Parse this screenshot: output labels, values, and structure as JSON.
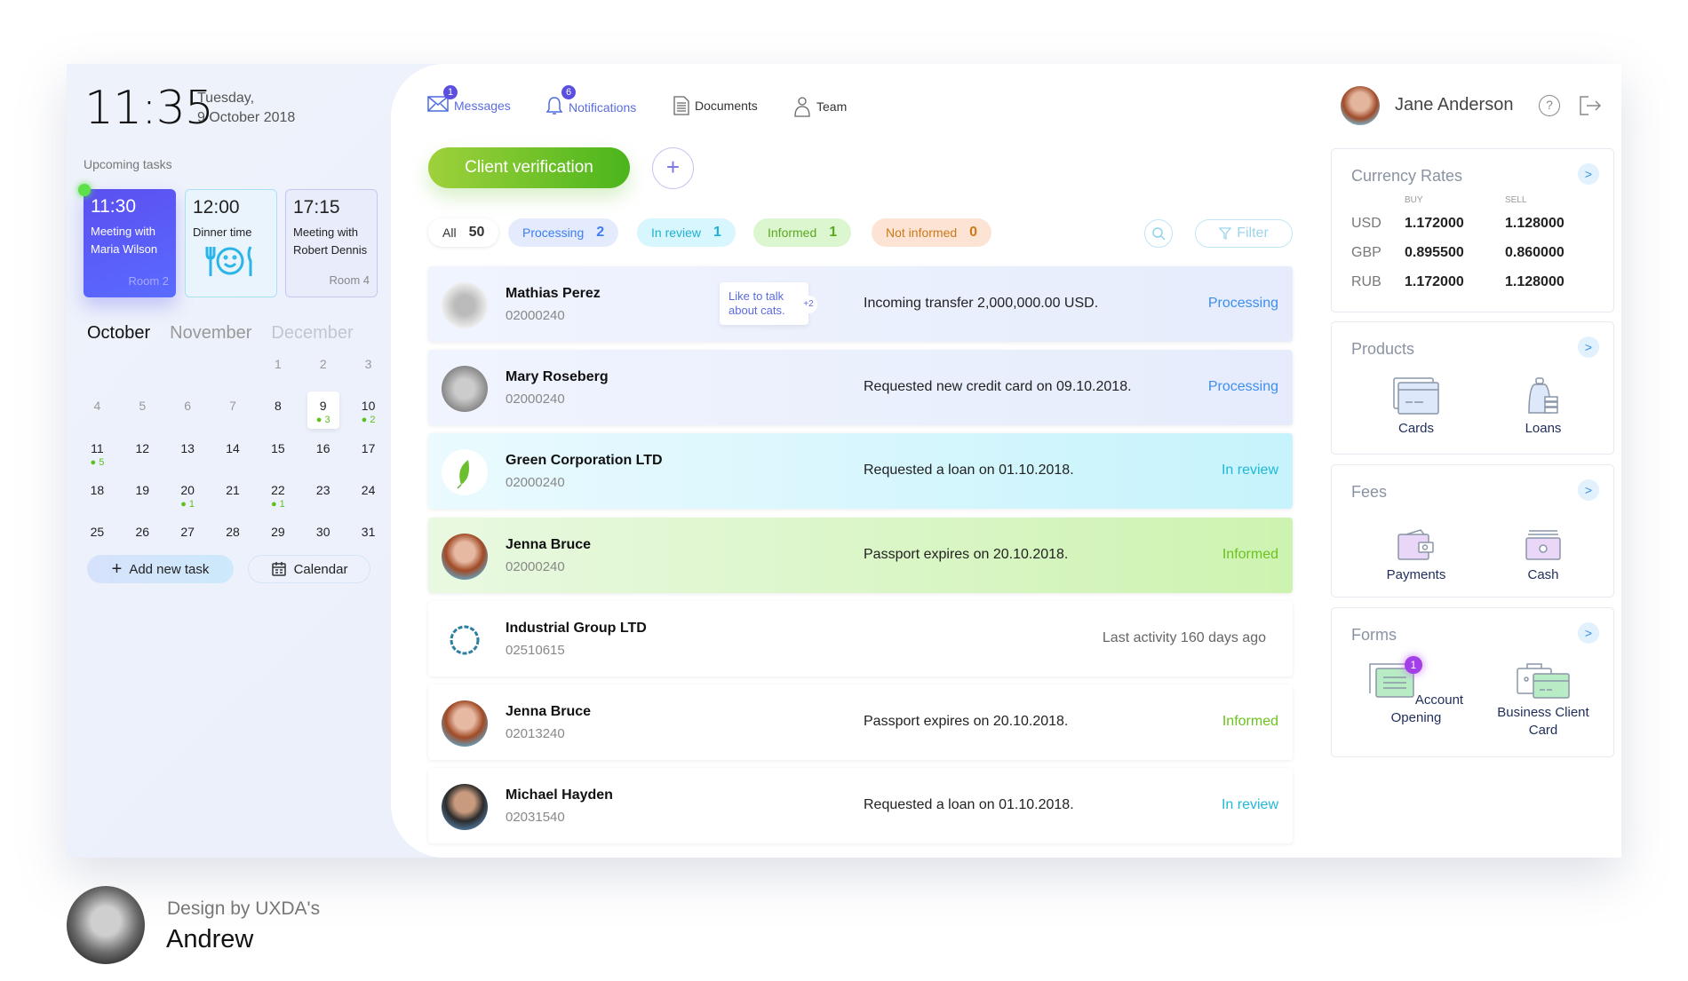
{
  "clock": {
    "time": "11:35",
    "weekday": "Tuesday,",
    "date": "9 October 2018"
  },
  "tasks": {
    "label": "Upcoming tasks",
    "items": [
      {
        "time": "11:30",
        "title": "Meeting with Maria Wilson",
        "room": "Room 2"
      },
      {
        "time": "12:00",
        "title": "Dinner time",
        "room": ""
      },
      {
        "time": "17:15",
        "title": "Meeting with Robert Dennis",
        "room": "Room 4"
      }
    ]
  },
  "calendar": {
    "months": [
      "October",
      "November",
      "December"
    ],
    "selected_day": "9",
    "days": [
      {
        "d": ""
      },
      {
        "d": ""
      },
      {
        "d": ""
      },
      {
        "d": ""
      },
      {
        "d": "1"
      },
      {
        "d": "2"
      },
      {
        "d": "3"
      },
      {
        "d": "4"
      },
      {
        "d": "5"
      },
      {
        "d": "6"
      },
      {
        "d": "7"
      },
      {
        "d": "8"
      },
      {
        "d": "9",
        "e": "3"
      },
      {
        "d": "10",
        "e": "2"
      },
      {
        "d": "11",
        "e": "5"
      },
      {
        "d": "12"
      },
      {
        "d": "13"
      },
      {
        "d": "14"
      },
      {
        "d": "15"
      },
      {
        "d": "16"
      },
      {
        "d": "17"
      },
      {
        "d": "18"
      },
      {
        "d": "19"
      },
      {
        "d": "20",
        "e": "1"
      },
      {
        "d": "21"
      },
      {
        "d": "22",
        "e": "1"
      },
      {
        "d": "23"
      },
      {
        "d": "24"
      },
      {
        "d": "25"
      },
      {
        "d": "26"
      },
      {
        "d": "27"
      },
      {
        "d": "28"
      },
      {
        "d": "29"
      },
      {
        "d": "30"
      },
      {
        "d": "31"
      }
    ],
    "add_task": "Add new task",
    "calendar_button": "Calendar"
  },
  "nav": [
    {
      "label": "Messages",
      "badge": "1",
      "icon": "envelope-icon"
    },
    {
      "label": "Notifications",
      "badge": "6",
      "icon": "bell-icon"
    },
    {
      "label": "Documents",
      "icon": "document-icon"
    },
    {
      "label": "Team",
      "icon": "person-icon"
    }
  ],
  "user": {
    "name": "Jane Anderson"
  },
  "actions": {
    "client_verification": "Client verification",
    "filter": "Filter"
  },
  "filters": [
    {
      "label": "All",
      "count": "50"
    },
    {
      "label": "Processing",
      "count": "2"
    },
    {
      "label": "In review",
      "count": "1"
    },
    {
      "label": "Informed",
      "count": "1"
    },
    {
      "label": "Not informed",
      "count": "0"
    }
  ],
  "clients": [
    {
      "name": "Mathias Perez",
      "id": "02000240",
      "note": "Like to talk about cats.",
      "note_more": "+2",
      "message": "Incoming transfer 2,000,000.00 USD.",
      "status": "Processing"
    },
    {
      "name": "Mary Roseberg",
      "id": "02000240",
      "message": "Requested new credit card on 09.10.2018.",
      "status": "Processing"
    },
    {
      "name": "Green Corporation LTD",
      "id": "02000240",
      "message": "Requested a loan on 01.10.2018.",
      "status": "In review"
    },
    {
      "name": "Jenna Bruce",
      "id": "02000240",
      "message": "Passport expires on 20.10.2018.",
      "status": "Informed"
    },
    {
      "name": "Industrial Group LTD",
      "id": "02510615",
      "message": "Last activity 160 days ago",
      "status": ""
    },
    {
      "name": "Jenna Bruce",
      "id": "02013240",
      "message": "Passport expires on 20.10.2018.",
      "status": "Informed"
    },
    {
      "name": "Michael Hayden",
      "id": "02031540",
      "message": "Requested a loan on 01.10.2018.",
      "status": "In review"
    }
  ],
  "status_colors": {
    "Processing": "#3d8ef0",
    "In review": "#20b8d8",
    "Informed": "#6cc21f"
  },
  "currency": {
    "title": "Currency Rates",
    "buy": "BUY",
    "sell": "SELL",
    "rows": [
      {
        "c": "USD",
        "b": "1.172000",
        "s": "1.128000"
      },
      {
        "c": "GBP",
        "b": "0.895500",
        "s": "0.860000"
      },
      {
        "c": "RUB",
        "b": "1.172000",
        "s": "1.128000"
      }
    ]
  },
  "products": {
    "title": "Products",
    "items": [
      "Cards",
      "Loans"
    ]
  },
  "fees": {
    "title": "Fees",
    "items": [
      "Payments",
      "Cash"
    ]
  },
  "forms": {
    "title": "Forms",
    "items": [
      "Account Opening",
      "Business Client Card"
    ],
    "badge": "1"
  },
  "credit": {
    "line1": "Design by UXDA's",
    "line2": "Andrew"
  }
}
